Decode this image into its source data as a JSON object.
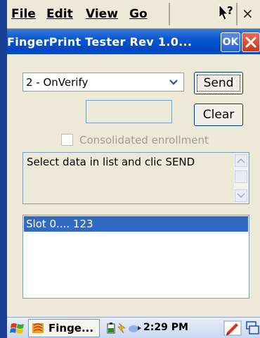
{
  "menu": {
    "file": "File",
    "edit": "Edit",
    "view": "View",
    "go": "Go",
    "help_icon": "help-cursor-icon",
    "close": "×"
  },
  "titlebar": {
    "title": "FingerPrint Tester Rev 1.0...",
    "ok": "OK",
    "close_icon": "close-icon"
  },
  "form": {
    "command_combo_value": "2 - OnVerify",
    "send_label": "Send",
    "clear_label": "Clear",
    "small_field_value": "",
    "consolidated_label": "Consolidated enrollment",
    "consolidated_checked": false,
    "consolidated_enabled": false,
    "info_text": "Select data in list and clic SEND",
    "list_items": [
      "Slot 0.... 123"
    ],
    "selected_index": 0
  },
  "taskbar": {
    "start_icon": "windows-flag-icon",
    "task_label": "Finge...",
    "time": "2:29 PM",
    "tray_icons": [
      "power-icon",
      "network-icon",
      "arrow-icon"
    ],
    "pen_icon": "pen-input-icon",
    "keyboard_icon": "keyboard-icon"
  },
  "colors": {
    "titlebar": "#0a56d0",
    "selection": "#316ac5",
    "background": "#ece9d8"
  }
}
